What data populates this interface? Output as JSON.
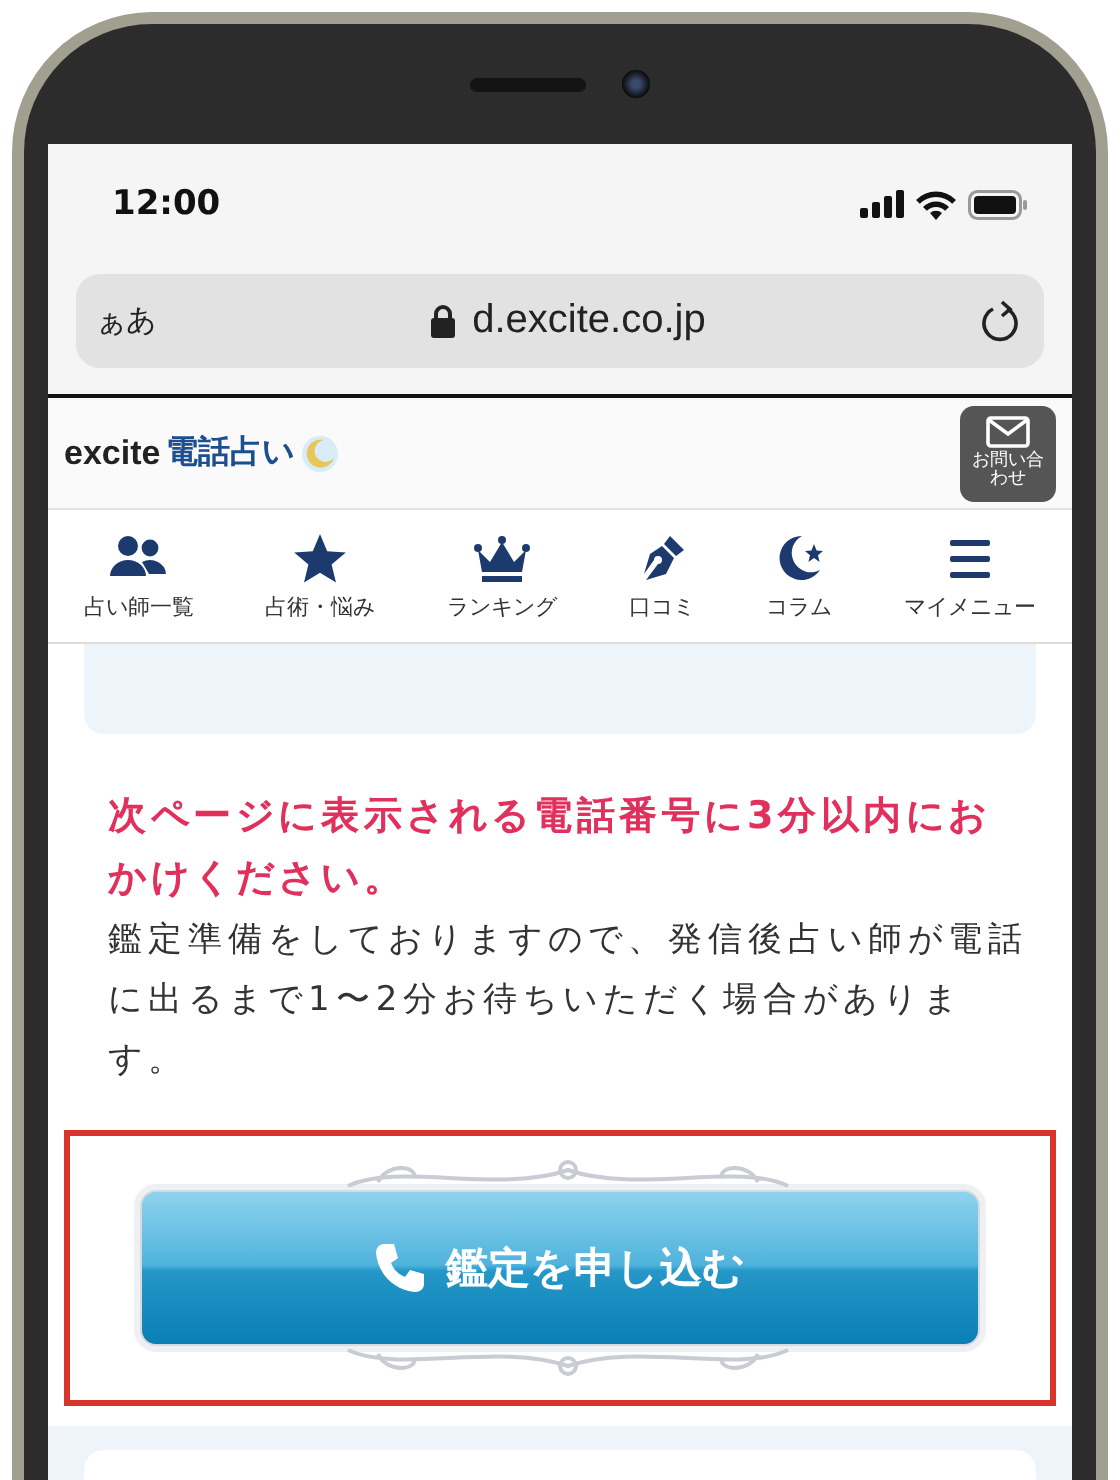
{
  "status_bar": {
    "time": "12:00"
  },
  "address_bar": {
    "text_size_label": "ぁあ",
    "url": "d.excite.co.jp"
  },
  "header": {
    "logo": {
      "brand": "excite",
      "service": "電話占い"
    },
    "contact_button": "お問い合わせ"
  },
  "nav": [
    {
      "kind": "people",
      "label": "占い師一覧"
    },
    {
      "kind": "star",
      "label": "占術・悩み"
    },
    {
      "kind": "crown",
      "label": "ランキング"
    },
    {
      "kind": "pen",
      "label": "口コミ"
    },
    {
      "kind": "moon",
      "label": "コラム"
    },
    {
      "kind": "menu",
      "label": "マイメニュー"
    }
  ],
  "notice": {
    "warning": "次ページに表示される電話番号に3分以内におかけください。",
    "body": "鑑定準備をしておりますので、発信後占い師が電話に出るまで1〜2分お待ちいただく場合があります。"
  },
  "apply_button": {
    "label": "鑑定を申し込む",
    "highlighted": true
  }
}
